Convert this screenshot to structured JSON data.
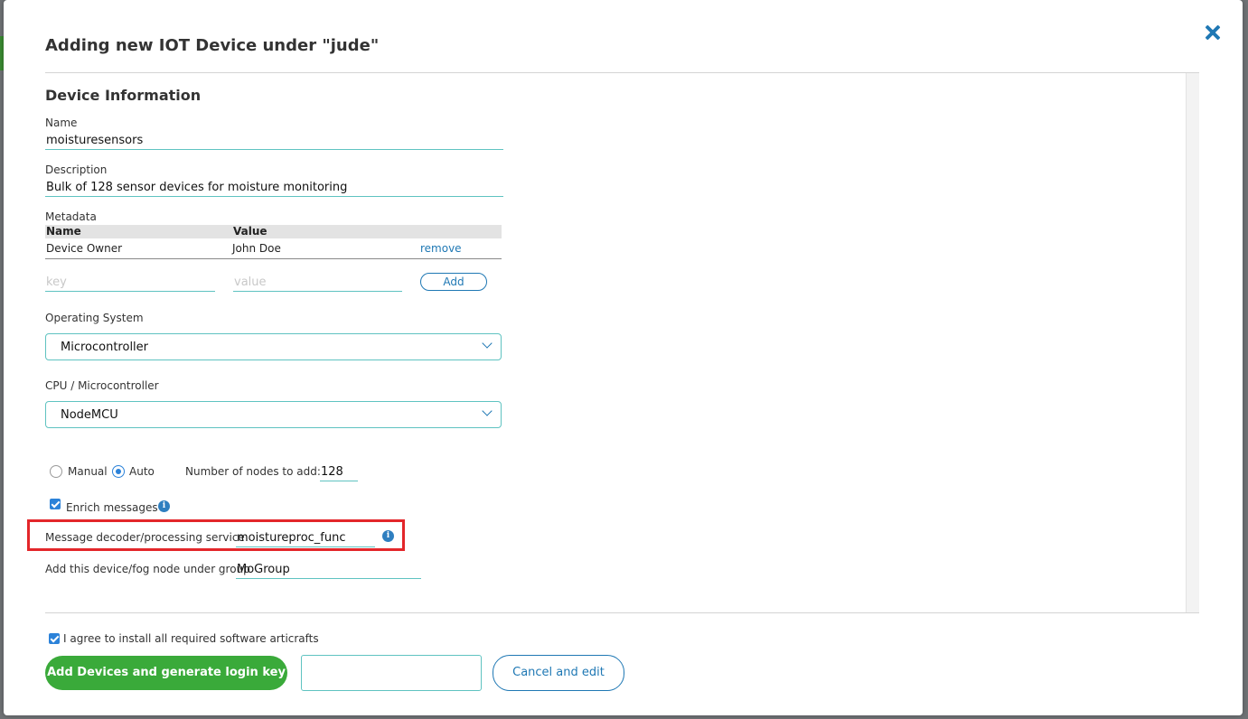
{
  "dialog": {
    "title": "Adding new IOT Device under \"jude\""
  },
  "device_info": {
    "section_title": "Device Information",
    "name_label": "Name",
    "name_value": "moisturesensors",
    "description_label": "Description",
    "description_value": "Bulk of 128 sensor devices for moisture monitoring",
    "metadata_label": "Metadata",
    "metadata_headers": {
      "name": "Name",
      "value": "Value"
    },
    "metadata_rows": [
      {
        "name": "Device Owner",
        "value": "John Doe",
        "action": "remove"
      }
    ],
    "key_placeholder": "key",
    "value_placeholder": "value",
    "add_label": "Add",
    "os_label": "Operating System",
    "os_value": "Microcontroller",
    "cpu_label": "CPU / Microcontroller",
    "cpu_value": "NodeMCU",
    "mode_manual_label": "Manual",
    "mode_auto_label": "Auto",
    "mode_selected": "Auto",
    "nodes_label": "Number of nodes to add:",
    "nodes_value": "128",
    "enrich_label": "Enrich messages",
    "enrich_checked": true,
    "decoder_label": "Message decoder/processing service",
    "decoder_value": "moistureproc_func",
    "group_label": "Add this device/fog node under group",
    "group_value": "MoGroup"
  },
  "footer": {
    "agree_label": "I agree to install all required software articrafts",
    "agree_checked": true,
    "primary_label": "Add Devices and generate login key",
    "secondary_value": "",
    "cancel_label": "Cancel and edit"
  },
  "colors": {
    "accent": "#1f78b4",
    "input_border": "#5fc3c1",
    "primary_button": "#3aaa3a",
    "highlight": "#e3262a"
  },
  "icons": {
    "close": "close-icon",
    "chevron": "chevron-down-icon",
    "info": "info-icon"
  }
}
